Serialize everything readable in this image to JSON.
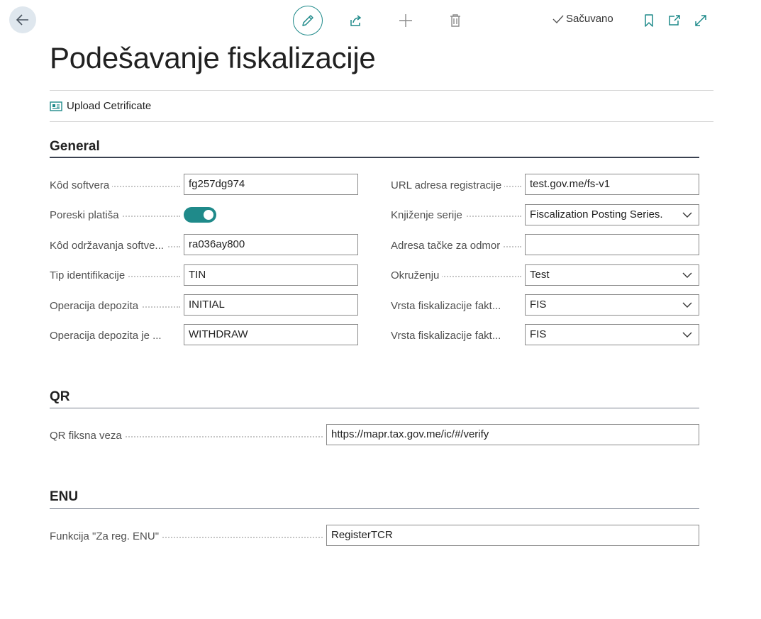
{
  "header": {
    "title": "Podešavanje fiskalizacije",
    "saved_label": "Sačuvano"
  },
  "actions": {
    "upload_certificate": "Upload Cetrificate"
  },
  "general": {
    "title": "General",
    "left_fields": [
      {
        "label": "Kôd softvera",
        "value": "fg257dg974"
      },
      {
        "label": "Poreski platiša",
        "value": true
      },
      {
        "label": "Kôd održavanja softve...",
        "value": "ra036ay800"
      },
      {
        "label": "Tip identifikacije",
        "value": "TIN"
      },
      {
        "label": "Operacija depozita",
        "value": "INITIAL"
      },
      {
        "label": "Operacija depozita je ...",
        "value": "WITHDRAW"
      }
    ],
    "right_fields": [
      {
        "label": "URL adresa registracije",
        "value": "test.gov.me/fs-v1"
      },
      {
        "label": "Knjiženje serije",
        "value": "Fiscalization Posting Series."
      },
      {
        "label": "Adresa tačke za odmor",
        "value": ""
      },
      {
        "label": "Okruženju",
        "value": "Test"
      },
      {
        "label": "Vrsta fiskalizacije fakt...",
        "value": "FIS"
      },
      {
        "label": "Vrsta fiskalizacije fakt...",
        "value": "FIS"
      }
    ]
  },
  "qr": {
    "title": "QR",
    "field_label": "QR fiksna veza",
    "field_value": "https://mapr.tax.gov.me/ic/#/verify"
  },
  "enu": {
    "title": "ENU",
    "field_label": "Funkcija \"Za reg. ENU\"",
    "field_value": "RegisterTCR"
  },
  "icons": [
    "back-arrow-icon",
    "pencil-icon",
    "share-icon",
    "plus-icon",
    "trash-icon",
    "checkmark-icon",
    "bookmark-icon",
    "open-in-new-icon",
    "expand-icon",
    "certificate-icon",
    "chevron-down-icon"
  ],
  "colors": {
    "accent": "#1f8a8a",
    "section_line": "#3a4150"
  }
}
